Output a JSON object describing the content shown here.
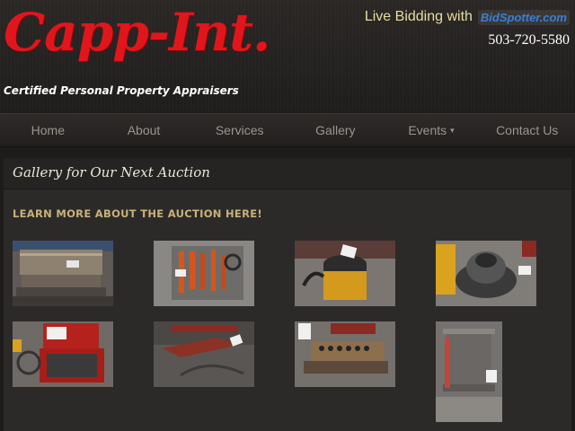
{
  "header": {
    "logo_text": "Capp-Int.",
    "tagline": "Certified Personal Property Appraisers",
    "live_bidding": "Live Bidding with",
    "bidspotter_brand": "BidSpotter.com",
    "phone": "503-720-5580"
  },
  "nav": {
    "items": [
      {
        "label": "Home"
      },
      {
        "label": "About"
      },
      {
        "label": "Services"
      },
      {
        "label": "Gallery"
      },
      {
        "label": "Events"
      },
      {
        "label": "Contact Us"
      }
    ],
    "events_caret": "▾"
  },
  "main": {
    "title": "Gallery for Our Next Auction",
    "learn_more": "Learn more about the auction here!"
  },
  "gallery": {
    "items": [
      {
        "icon": "sheet-metal-brake-photo"
      },
      {
        "icon": "hydraulic-tool-kit-photo"
      },
      {
        "icon": "shop-vac-photo"
      },
      {
        "icon": "shop-vac-canister-photo"
      },
      {
        "icon": "red-tool-case-photo"
      },
      {
        "icon": "floor-jack-photo"
      },
      {
        "icon": "metal-parts-tray-photo"
      },
      {
        "icon": "metal-bracket-photo"
      }
    ]
  },
  "colors": {
    "logo_red": "#e0161c",
    "live_text": "#e9dca0",
    "nav_text": "#9a958f",
    "link_gold": "#c8b27a",
    "panel_bg": "#2c2a29"
  }
}
